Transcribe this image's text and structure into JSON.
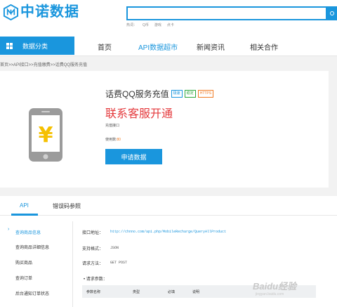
{
  "header": {
    "logo_text": "中诺数据",
    "search_placeholder": "",
    "hot_label": "热词：",
    "hot_words": [
      "Q币",
      "游戏",
      "点卡"
    ]
  },
  "nav": {
    "category_label": "数据分类",
    "items": [
      {
        "label": "首页",
        "active": false
      },
      {
        "label": "API数据超市",
        "active": true
      },
      {
        "label": "新闻资讯",
        "active": false
      },
      {
        "label": "相关合作",
        "active": false
      }
    ]
  },
  "breadcrumb": "首页>>API接口>>充值缴费>>话费QQ服务充值",
  "product": {
    "title": "话费QQ服务充值",
    "tags": [
      "极速",
      "稳定",
      "HTTPS"
    ],
    "price_text": "联系客服开通",
    "subtitle": "充值接口",
    "usage_label": "使用数:",
    "usage_count": "80",
    "apply_button": "申请数据",
    "icon_symbol": "¥"
  },
  "tabs": [
    "API",
    "错误码参照"
  ],
  "sidebar": [
    {
      "label": "查询商品信息",
      "active": true
    },
    {
      "label": "查询商品详细信息",
      "active": false
    },
    {
      "label": "购买商品",
      "active": false
    },
    {
      "label": "查询订单",
      "active": false
    },
    {
      "label": "后台通知订单状态",
      "active": false
    }
  ],
  "api": {
    "url_label": "接口地址：",
    "url_value": "http://chnno.com/api.php/MobileRecharge/QueryAllProduct",
    "format_label": "支持格式：",
    "format_value": "JSON",
    "method_label": "请求方法：",
    "method_value": "GET POST",
    "params_title": "请求参数：",
    "columns": [
      "参数名称",
      "类型",
      "必填",
      "说明"
    ]
  },
  "watermark": {
    "text": "Baidu经验",
    "url": "jingyan.baidu.com"
  },
  "colors": {
    "primary": "#1a96dd",
    "price": "#e4393c",
    "tag_green": "#2aa63a",
    "tag_orange": "#f07a22",
    "phone_body": "#9b9b9b",
    "coin": "#f5c000"
  }
}
